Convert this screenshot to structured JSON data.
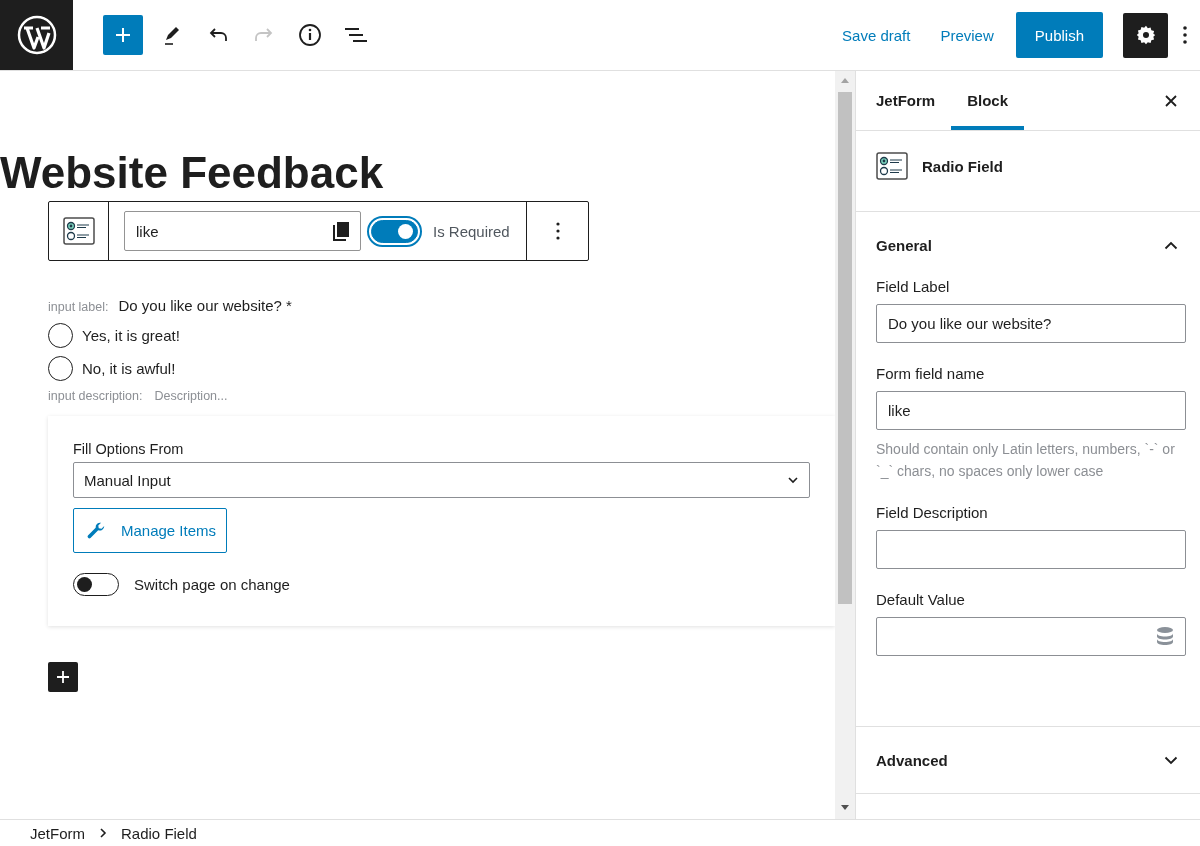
{
  "top_bar": {
    "redo_disabled": true,
    "save_draft": "Save draft",
    "preview": "Preview",
    "publish": "Publish",
    "settings_pressed": true
  },
  "editor": {
    "title": "Website Feedback",
    "block_toolbar": {
      "field_name": "like",
      "required": {
        "label": "Is Required",
        "on": true
      }
    },
    "radio_field": {
      "label_prefix": "input label:",
      "label": "Do you like our website? *",
      "options": [
        {
          "label": "Yes, it is great!",
          "selected": false
        },
        {
          "label": "No, it is awful!",
          "selected": false
        }
      ],
      "description_prefix": "input description:",
      "description_placeholder": "Description..."
    },
    "options_panel": {
      "fill_label": "Fill Options From",
      "fill_value": "Manual Input",
      "manage_button": "Manage Items",
      "switch": {
        "label": "Switch page on change",
        "on": false
      }
    }
  },
  "sidebar": {
    "tabs": [
      {
        "label": "JetForm",
        "selected": false
      },
      {
        "label": "Block",
        "selected": true
      }
    ],
    "block_name": "Radio Field",
    "general": {
      "title": "General",
      "expanded": true,
      "fields": [
        {
          "label": "Field Label",
          "value": "Do you like our website?"
        },
        {
          "label": "Form field name",
          "value": "like",
          "help": "Should contain only Latin letters, numbers, `-` or `_` chars, no spaces only lower case"
        },
        {
          "label": "Field Description"
        },
        {
          "label": "Default Value",
          "dynamic": true
        }
      ]
    },
    "advanced": {
      "title": "Advanced",
      "expanded": false
    }
  },
  "breadcrumb": [
    "JetForm",
    "Radio Field"
  ]
}
